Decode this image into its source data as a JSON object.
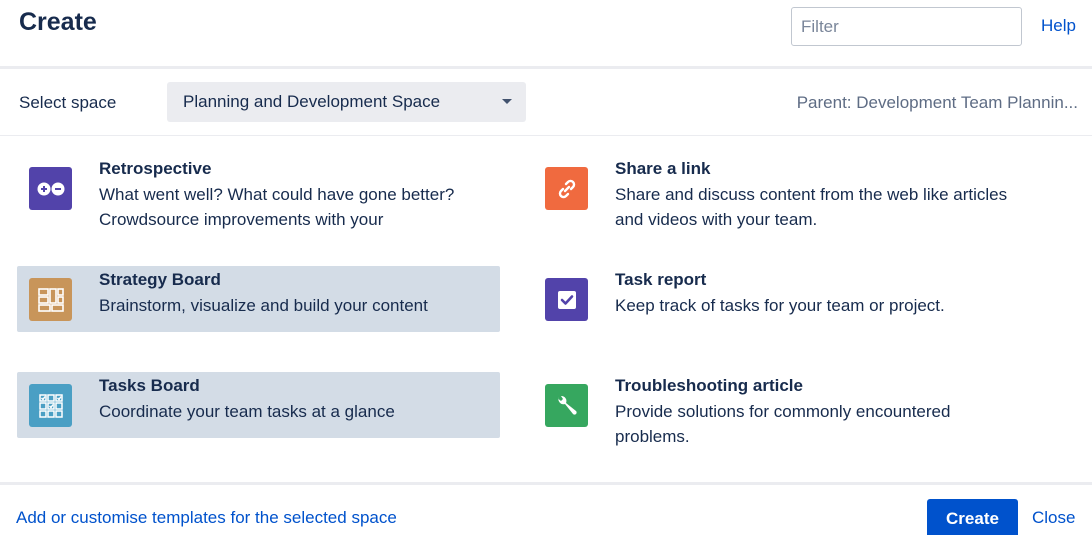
{
  "header": {
    "title": "Create",
    "filter_placeholder": "Filter",
    "help_label": "Help"
  },
  "space": {
    "label": "Select space",
    "selected": "Planning and Development Space",
    "parent": "Parent: Development Team Plannin..."
  },
  "templates": [
    {
      "name": "Retrospective",
      "description": "What went well? What could have gone better? Crowdsource improvements with your",
      "icon": "retrospective-icon",
      "color": "#5243aa",
      "selected": false
    },
    {
      "name": "Share a link",
      "description": "Share and discuss content from the web like articles and videos with your team.",
      "icon": "link-icon",
      "color": "#f06a3f",
      "selected": false
    },
    {
      "name": "Strategy Board",
      "description": "Brainstorm, visualize and build your content",
      "icon": "strategy-board-icon",
      "color": "#c8955a",
      "selected": true
    },
    {
      "name": "Task report",
      "description": "Keep track of tasks for your team or project.",
      "icon": "task-report-icon",
      "color": "#5243aa",
      "selected": false
    },
    {
      "name": "Tasks Board",
      "description": "Coordinate your team tasks at a glance",
      "icon": "tasks-board-icon",
      "color": "#4a9fc4",
      "selected": true
    },
    {
      "name": "Troubleshooting article",
      "description": "Provide solutions for commonly encountered problems.",
      "icon": "wrench-icon",
      "color": "#36a75f",
      "selected": false
    }
  ],
  "footer": {
    "customise_link": "Add or customise templates for the selected space",
    "create_label": "Create",
    "close_label": "Close"
  }
}
